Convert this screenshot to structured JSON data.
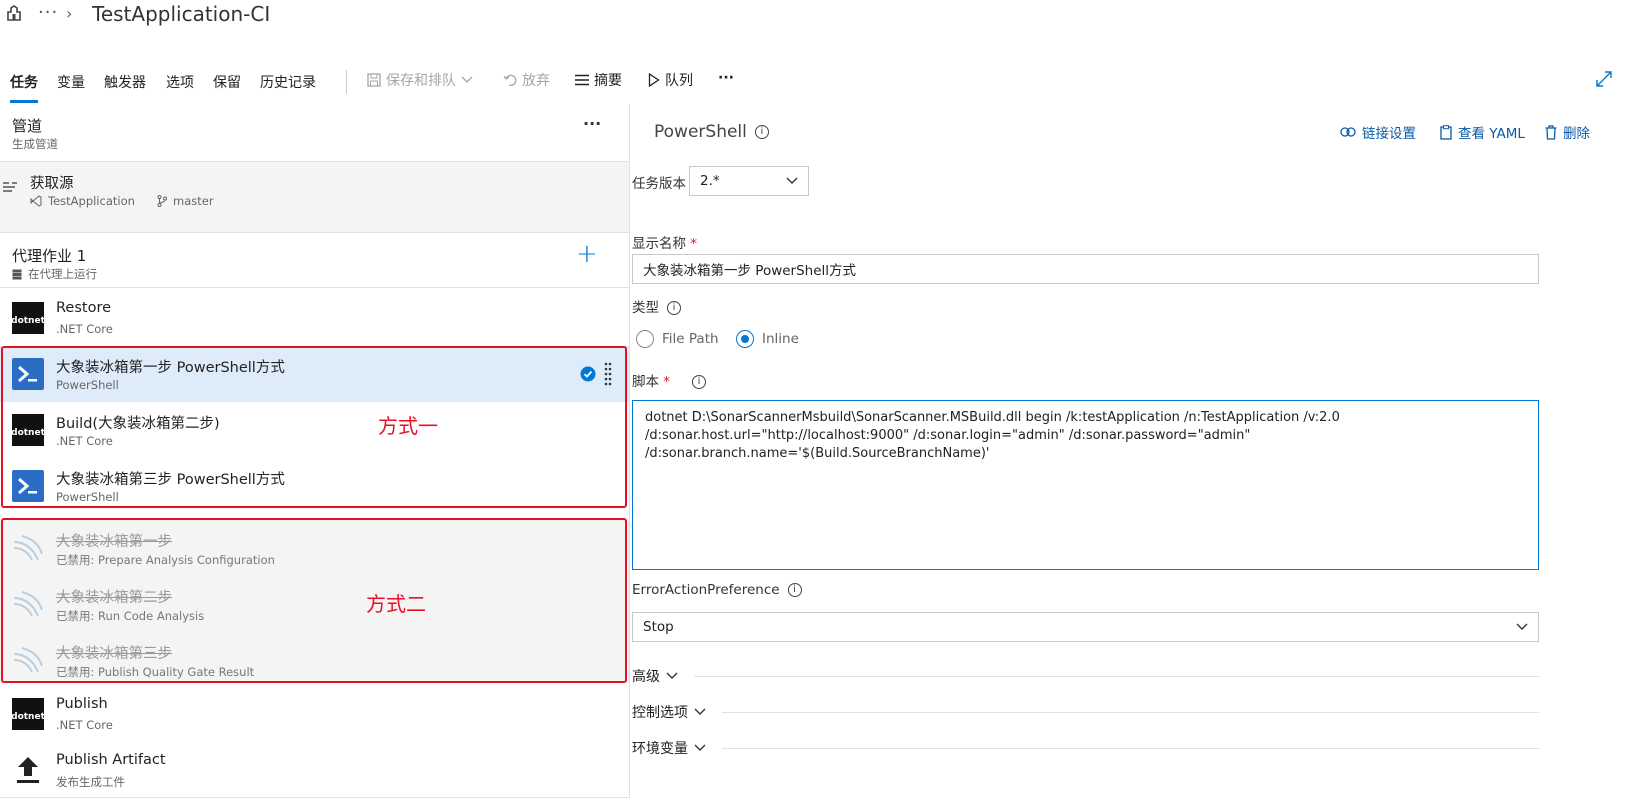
{
  "header": {
    "title": "TestApplication-CI",
    "more": "···"
  },
  "tabs": [
    {
      "label": "任务",
      "active": true
    },
    {
      "label": "变量"
    },
    {
      "label": "触发器"
    },
    {
      "label": "选项"
    },
    {
      "label": "保留"
    },
    {
      "label": "历史记录"
    }
  ],
  "toolbar": {
    "save_queue": "保存和排队",
    "discard": "放弃",
    "summary": "摘要",
    "queue": "队列",
    "more": "···"
  },
  "pipeline": {
    "title": "管道",
    "subtitle": "生成管道",
    "more": "···"
  },
  "source": {
    "title": "获取源",
    "repo": "TestApplication",
    "branch": "master"
  },
  "agent_job": {
    "title": "代理作业 1",
    "subtitle": "在代理上运行",
    "add": "+"
  },
  "tasks": [
    {
      "name": "Restore",
      "sub": ".NET Core",
      "icon": "dotnet-icon"
    },
    {
      "name": "大象装冰箱第一步 PowerShell方式",
      "sub": "PowerShell",
      "icon": "powershell-icon",
      "selected": true
    },
    {
      "name": "Build(大象装冰箱第二步)",
      "sub": ".NET Core",
      "icon": "dotnet-icon"
    },
    {
      "name": "大象装冰箱第三步 PowerShell方式",
      "sub": "PowerShell",
      "icon": "powershell-icon"
    },
    {
      "name": "大象装冰箱第一步",
      "sub": "已禁用: Prepare Analysis Configuration",
      "icon": "sonar-icon",
      "disabled": true
    },
    {
      "name": "大象装冰箱第二步",
      "sub": "已禁用: Run Code Analysis",
      "icon": "sonar-icon",
      "disabled": true
    },
    {
      "name": "大象装冰箱第三步",
      "sub": "已禁用: Publish Quality Gate Result",
      "icon": "sonar-icon",
      "disabled": true
    },
    {
      "name": "Publish",
      "sub": ".NET Core",
      "icon": "dotnet-icon"
    },
    {
      "name": "Publish Artifact",
      "sub": "发布生成工件",
      "icon": "upload-icon"
    }
  ],
  "dotnet_logo_text": "dotnet",
  "annotations": {
    "method1": "方式一",
    "method2": "方式二"
  },
  "detail": {
    "title": "PowerShell",
    "link_settings": "链接设置",
    "view_yaml": "查看 YAML",
    "delete": "删除",
    "task_version_label": "任务版本",
    "task_version": "2.*",
    "display_name_label": "显示名称",
    "required_mark": "*",
    "display_name": "大象装冰箱第一步 PowerShell方式",
    "type_label": "类型",
    "type_options": [
      "File Path",
      "Inline"
    ],
    "type_selected": "Inline",
    "script_label": "脚本",
    "script": "dotnet D:\\SonarScannerMsbuild\\SonarScanner.MSBuild.dll begin /k:testApplication /n:TestApplication /v:2.0 /d:sonar.host.url=\"http://localhost:9000\" /d:sonar.login=\"admin\" /d:sonar.password=\"admin\"  /d:sonar.branch.name='$(Build.SourceBranchName)'",
    "error_pref_label": "ErrorActionPreference",
    "error_pref_value": "Stop",
    "sections": [
      "高级",
      "控制选项",
      "环境变量"
    ]
  },
  "colors": {
    "accent": "#0078d4",
    "annotation_red": "#e81123",
    "selected_row": "#deecf9",
    "panel_gray": "#f4f4f4"
  }
}
